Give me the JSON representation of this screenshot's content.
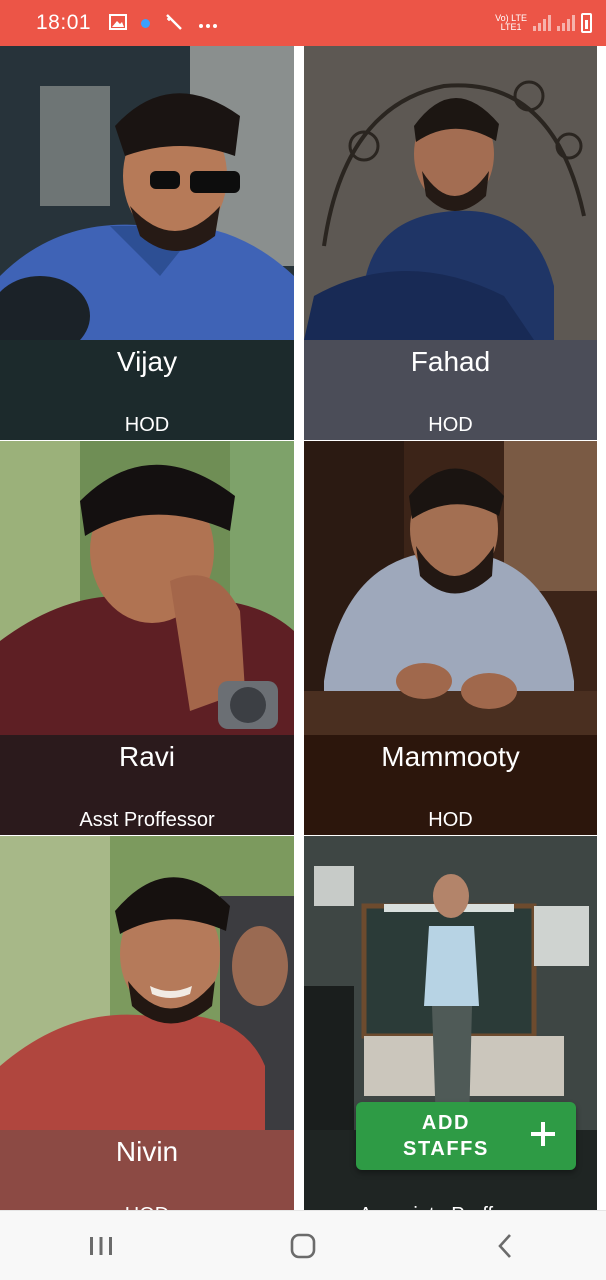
{
  "status_bar": {
    "time": "18:01",
    "icons": [
      "image-icon",
      "notification-dot-icon",
      "magic-wand-icon",
      "more-icon"
    ],
    "network_label_1": "Vo) LTE",
    "network_label_2": "LTE1",
    "right_icons": [
      "signal-icon",
      "signal-icon",
      "battery-icon"
    ]
  },
  "staff": [
    {
      "name": "Vijay",
      "role": "HOD",
      "info_color": "#1c2a2c"
    },
    {
      "name": "Fahad",
      "role": "HOD",
      "info_color": "#4b4d58"
    },
    {
      "name": "Ravi",
      "role": "Asst Proffessor",
      "info_color": "#2b1a1c"
    },
    {
      "name": "Mammooty",
      "role": "HOD",
      "info_color": "#2c160c"
    },
    {
      "name": "Nivin",
      "role": "HOD",
      "info_color": "#8c4a44"
    },
    {
      "name": "",
      "role": "Associate Proffessor",
      "info_color": "#1f2523"
    }
  ],
  "fab": {
    "label": "ADD STAFFS",
    "icon": "plus-icon",
    "color": "#2e9b45"
  },
  "nav_bar": {
    "buttons": [
      "recent-apps-icon",
      "home-icon",
      "back-icon"
    ]
  },
  "colors": {
    "status_bar": "#ec5547"
  }
}
